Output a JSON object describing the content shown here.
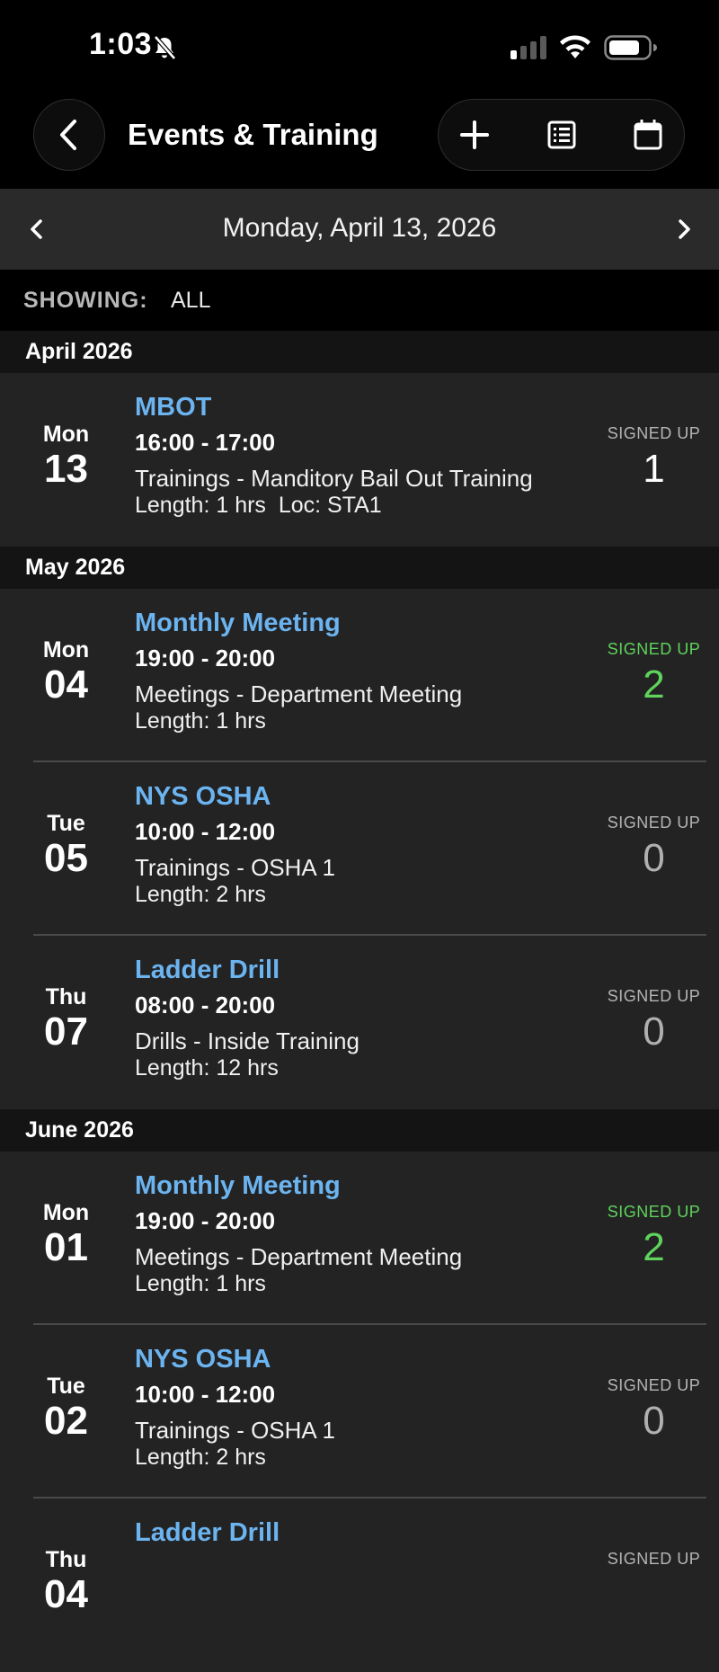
{
  "status": {
    "time": "1:03"
  },
  "nav": {
    "title": "Events & Training"
  },
  "date_bar": {
    "date": "Monday, April 13, 2026"
  },
  "filter": {
    "label": "SHOWING:",
    "value": "ALL"
  },
  "signed_up_label": "SIGNED UP",
  "colors": {
    "accent_blue": "#6cb4f0",
    "green": "#5fd35b",
    "background": "#232324"
  },
  "months": [
    {
      "name": "April 2026",
      "events": [
        {
          "dow": "Mon",
          "day": "13",
          "title": "MBOT",
          "time": "16:00 - 17:00",
          "desc": "Trainings - Manditory Bail Out Training",
          "length": "Length: 1 hrs  Loc: STA1",
          "signed_up": "1",
          "state": "white"
        }
      ]
    },
    {
      "name": "May 2026",
      "events": [
        {
          "dow": "Mon",
          "day": "04",
          "title": "Monthly Meeting",
          "time": "19:00 - 20:00",
          "desc": "Meetings - Department Meeting",
          "length": "Length: 1 hrs",
          "signed_up": "2",
          "state": "green"
        },
        {
          "dow": "Tue",
          "day": "05",
          "title": "NYS OSHA",
          "time": "10:00 - 12:00",
          "desc": "Trainings - OSHA 1",
          "length": "Length: 2 hrs",
          "signed_up": "0",
          "state": "gray"
        },
        {
          "dow": "Thu",
          "day": "07",
          "title": "Ladder Drill",
          "time": "08:00 - 20:00",
          "desc": "Drills - Inside Training",
          "length": "Length: 12 hrs",
          "signed_up": "0",
          "state": "gray"
        }
      ]
    },
    {
      "name": "June 2026",
      "events": [
        {
          "dow": "Mon",
          "day": "01",
          "title": "Monthly Meeting",
          "time": "19:00 - 20:00",
          "desc": "Meetings - Department Meeting",
          "length": "Length: 1 hrs",
          "signed_up": "2",
          "state": "green"
        },
        {
          "dow": "Tue",
          "day": "02",
          "title": "NYS OSHA",
          "time": "10:00 - 12:00",
          "desc": "Trainings - OSHA 1",
          "length": "Length: 2 hrs",
          "signed_up": "0",
          "state": "gray"
        },
        {
          "dow": "Thu",
          "day": "04",
          "title": "Ladder Drill",
          "time": "",
          "desc": "",
          "length": "",
          "signed_up": "",
          "state": "gray"
        }
      ]
    }
  ]
}
